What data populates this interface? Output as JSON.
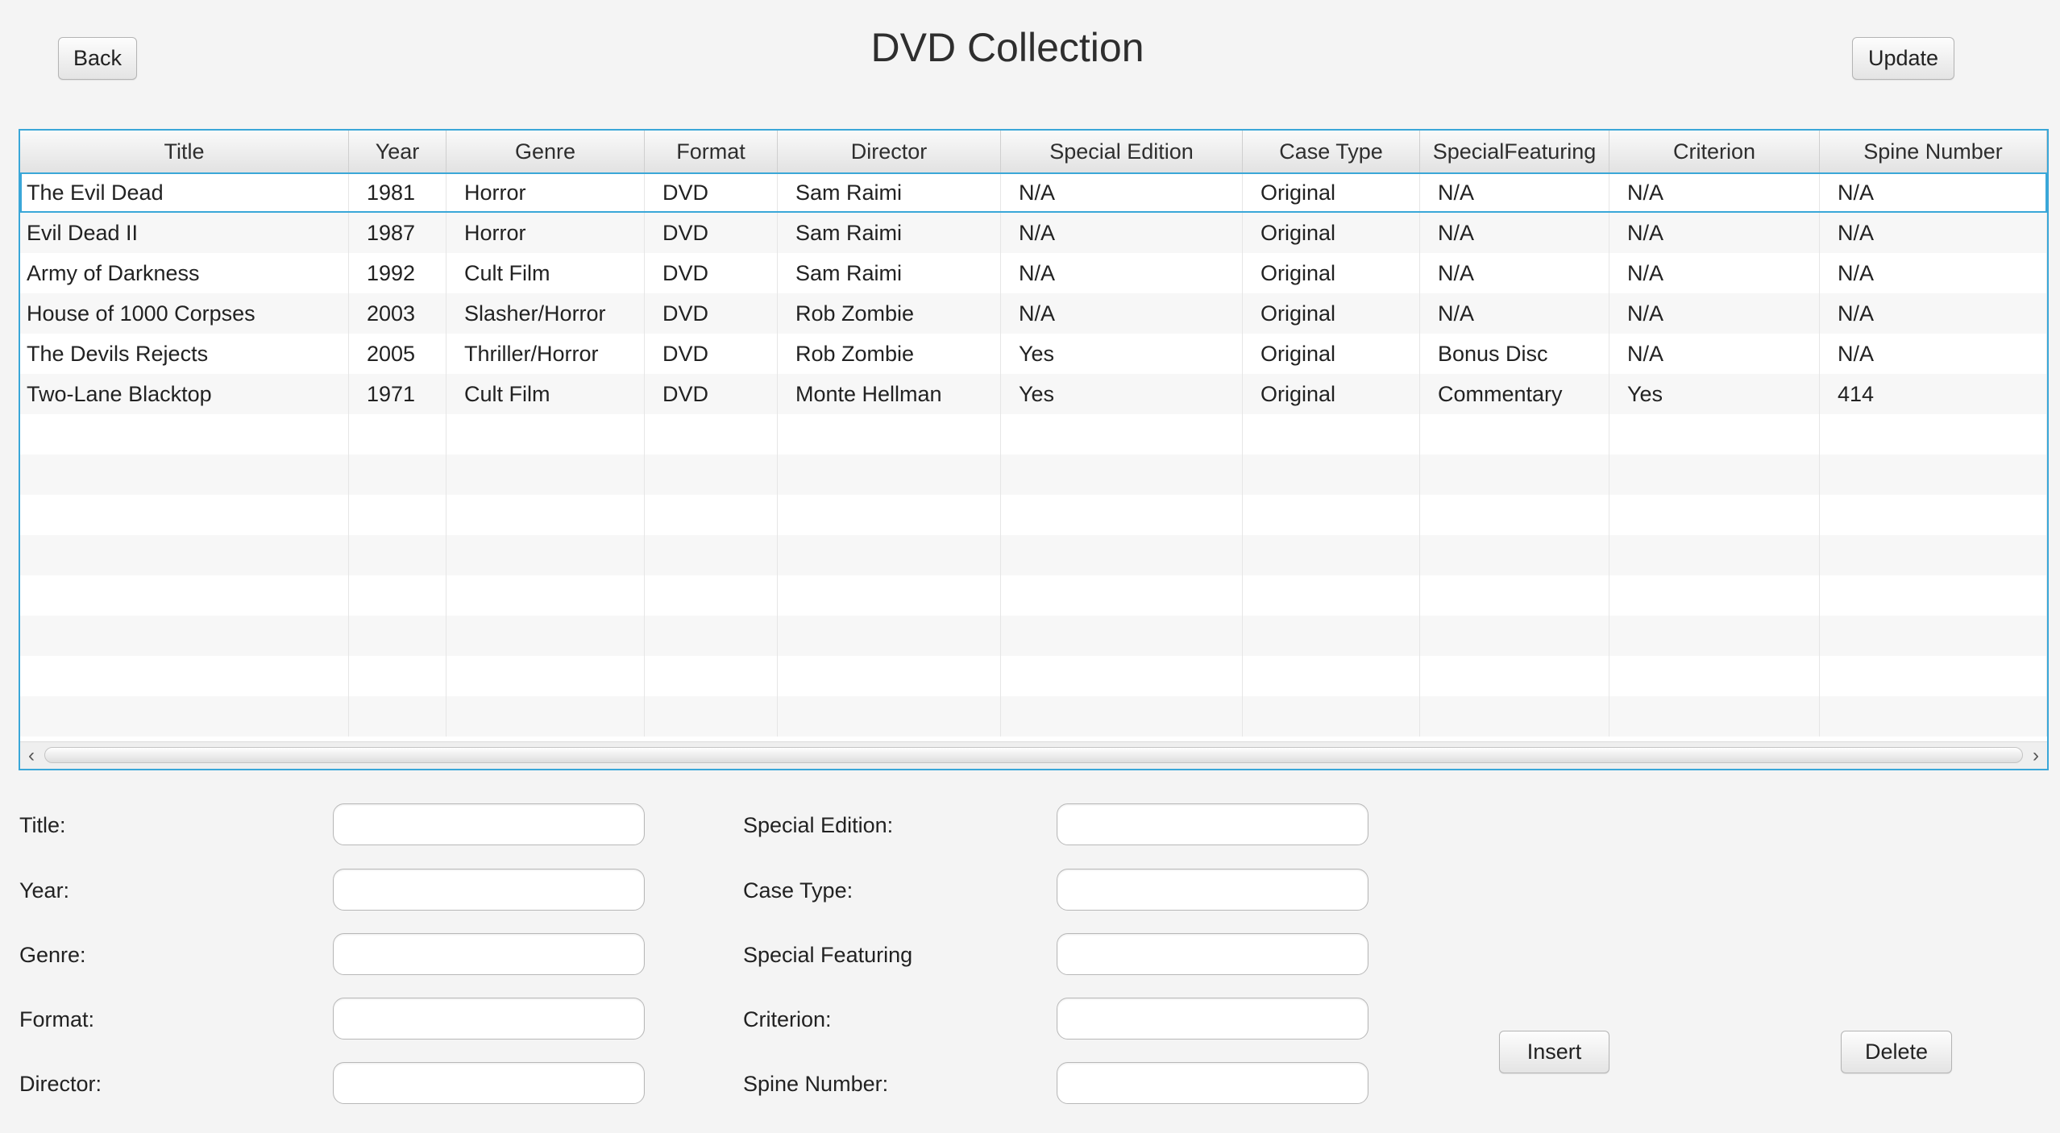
{
  "header": {
    "title": "DVD Collection",
    "back_label": "Back",
    "update_label": "Update"
  },
  "table": {
    "columns": [
      "Title",
      "Year",
      "Genre",
      "Format",
      "Director",
      "Special Edition",
      "Case Type",
      "SpecialFeaturing",
      "Criterion",
      "Spine Number"
    ],
    "rows": [
      [
        "The Evil Dead",
        "1981",
        "Horror",
        "DVD",
        "Sam Raimi",
        "N/A",
        "Original",
        "N/A",
        "N/A",
        "N/A"
      ],
      [
        "Evil Dead II",
        "1987",
        "Horror",
        "DVD",
        "Sam Raimi",
        "N/A",
        "Original",
        "N/A",
        "N/A",
        "N/A"
      ],
      [
        "Army of Darkness",
        "1992",
        "Cult Film",
        "DVD",
        "Sam Raimi",
        "N/A",
        "Original",
        "N/A",
        "N/A",
        "N/A"
      ],
      [
        "House of 1000 Corpses",
        "2003",
        "Slasher/Horror",
        "DVD",
        "Rob Zombie",
        "N/A",
        "Original",
        "N/A",
        "N/A",
        "N/A"
      ],
      [
        "The Devils Rejects",
        "2005",
        "Thriller/Horror",
        "DVD",
        "Rob Zombie",
        "Yes",
        "Original",
        "Bonus Disc",
        "N/A",
        "N/A"
      ],
      [
        "Two-Lane Blacktop",
        "1971",
        "Cult Film",
        "DVD",
        "Monte Hellman",
        "Yes",
        "Original",
        "Commentary",
        "Yes",
        "414"
      ]
    ],
    "empty_rows": 8,
    "selected_row": 0,
    "selection_color": "#3aa7d8"
  },
  "form": {
    "left": [
      {
        "label": "Title:",
        "value": ""
      },
      {
        "label": "Year:",
        "value": ""
      },
      {
        "label": "Genre:",
        "value": ""
      },
      {
        "label": "Format:",
        "value": ""
      },
      {
        "label": "Director:",
        "value": ""
      }
    ],
    "right": [
      {
        "label": "Special Edition:",
        "value": ""
      },
      {
        "label": "Case Type:",
        "value": ""
      },
      {
        "label": "Special Featuring",
        "value": ""
      },
      {
        "label": "Criterion:",
        "value": ""
      },
      {
        "label": "Spine Number:",
        "value": ""
      }
    ],
    "insert_label": "Insert",
    "delete_label": "Delete"
  },
  "icons": {
    "scroll_left": "chevron-left-icon",
    "scroll_right": "chevron-right-icon"
  }
}
